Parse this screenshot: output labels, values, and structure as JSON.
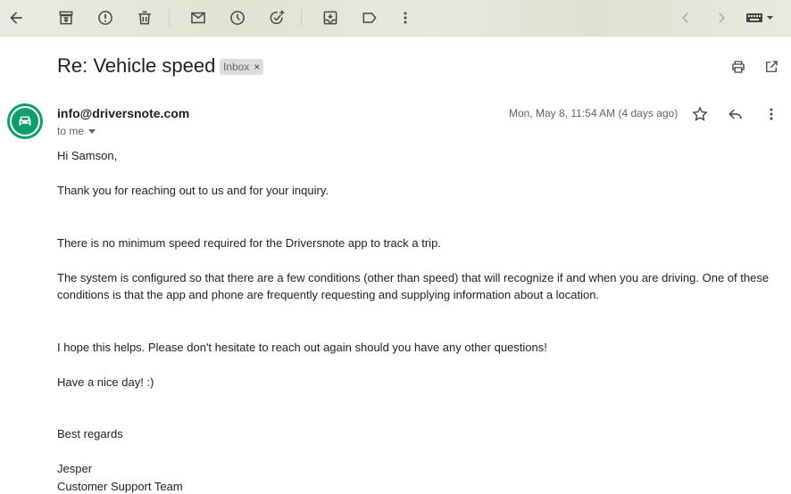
{
  "toolbar": {
    "icons": [
      "back-arrow-icon",
      "archive-icon",
      "report-spam-icon",
      "delete-icon",
      "mark-unread-icon",
      "snooze-icon",
      "add-task-icon",
      "move-to-icon",
      "label-icon",
      "more-vert-icon",
      "older-icon",
      "newer-icon",
      "keyboard-icon"
    ]
  },
  "email": {
    "subject": "Re: Vehicle speed",
    "label": "Inbox",
    "label_close": "×",
    "sender": "info@driversnote.com",
    "recipient": "to me",
    "date": "Mon, May 8, 11:54 AM (4 days ago)",
    "body": {
      "greeting": "Hi Samson,",
      "p1": "Thank you for reaching out to us and for your inquiry.",
      "p2": "There is no minimum speed required for the Driversnote app to track a trip.",
      "p3a": "The system is configured so that there are a few conditions (other than speed) that will recognize if and when you are driving. One of these",
      "p3b": "conditions is that the app and phone are frequently requesting and supplying information about a location.",
      "p4": "I hope this helps. Please don't hesitate to reach out again should you have any other questions!",
      "p5": "Have a nice day! :)",
      "closing": "Best regards",
      "name": "Jesper",
      "team": "Customer Support Team"
    }
  },
  "colors": {
    "avatar": "#0f9d6b",
    "icon": "#444746"
  }
}
